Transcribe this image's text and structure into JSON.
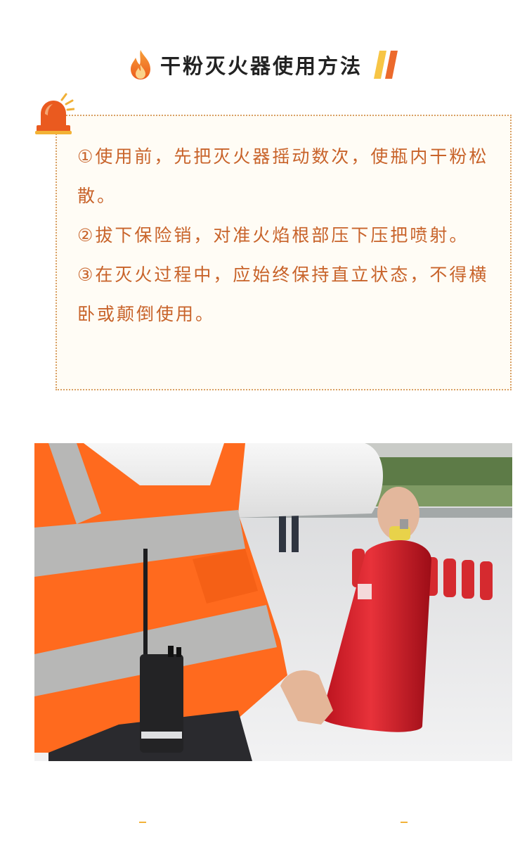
{
  "header": {
    "title": "干粉灭火器使用方法",
    "icon_left": "flame-icon",
    "icon_right": "double-stripe-icon"
  },
  "box": {
    "icon": "siren-icon",
    "steps": [
      "①使用前，先把灭火器摇动数次，使瓶内干粉松散。",
      "②拔下保险销，对准火焰根部压下压把喷射。",
      "③在灭火过程中，应始终保持直立状态，不得横卧或颠倒使用。"
    ]
  },
  "photo": {
    "subject": "worker-in-safety-vest-holding-fire-extinguisher"
  },
  "colors": {
    "accent": "#c8632a",
    "flame_orange": "#f06a1e",
    "stripe_yellow": "#f7c545",
    "border": "#d9a064",
    "box_background": "#fffcf5"
  }
}
